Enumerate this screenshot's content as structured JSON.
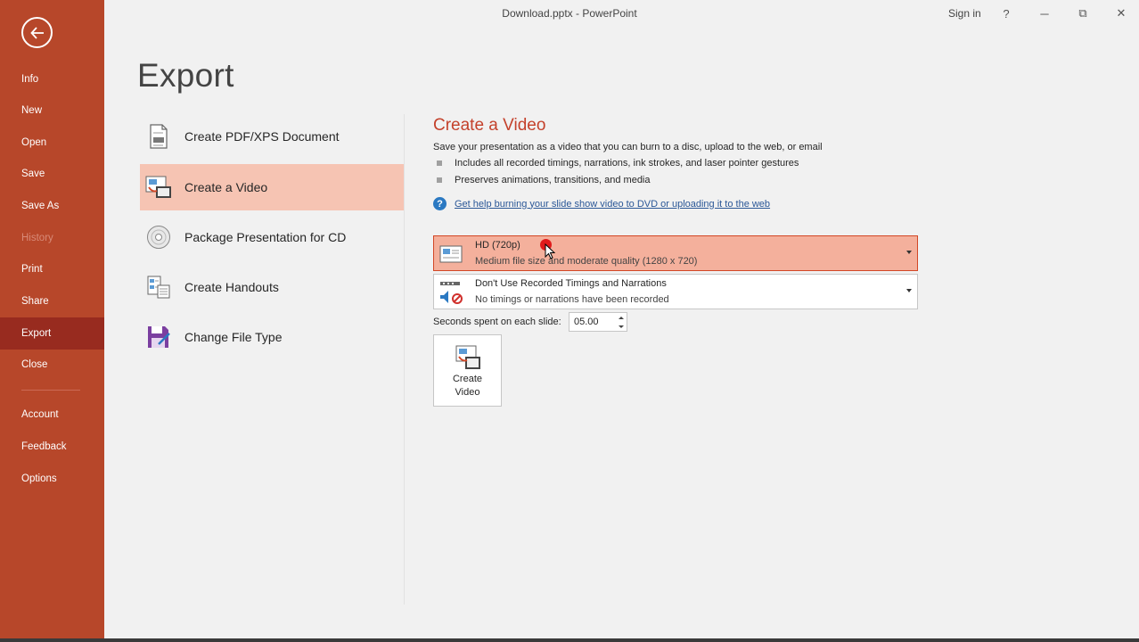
{
  "window": {
    "title": "Download.pptx  -  PowerPoint",
    "sign_in": "Sign in",
    "help": "?",
    "minimize": "─",
    "restore": "⧉",
    "close": "✕"
  },
  "sidebar": {
    "items": [
      {
        "label": "Info"
      },
      {
        "label": "New"
      },
      {
        "label": "Open"
      },
      {
        "label": "Save"
      },
      {
        "label": "Save As"
      },
      {
        "label": "History"
      },
      {
        "label": "Print"
      },
      {
        "label": "Share"
      },
      {
        "label": "Export"
      },
      {
        "label": "Close"
      },
      {
        "label": "Account"
      },
      {
        "label": "Feedback"
      },
      {
        "label": "Options"
      }
    ],
    "active": "Export",
    "disabled": "History"
  },
  "page": {
    "title": "Export"
  },
  "export_options": [
    {
      "label": "Create PDF/XPS Document",
      "icon": "pdf-document-icon"
    },
    {
      "label": "Create a Video",
      "icon": "video-icon"
    },
    {
      "label": "Package Presentation for CD",
      "icon": "cd-icon"
    },
    {
      "label": "Create Handouts",
      "icon": "handouts-icon"
    },
    {
      "label": "Change File Type",
      "icon": "save-file-type-icon"
    }
  ],
  "video_pane": {
    "title": "Create a Video",
    "description": "Save your presentation as a video that you can burn to a disc, upload to the web, or email",
    "bullets": [
      "Includes all recorded timings, narrations, ink strokes, and laser pointer gestures",
      "Preserves animations, transitions, and media"
    ],
    "help_link": "Get help burning your slide show video to DVD or uploading it to the web",
    "quality": {
      "title": "HD (720p)",
      "subtitle": "Medium file size and moderate quality (1280 x 720)"
    },
    "timings": {
      "title": "Don't Use Recorded Timings and Narrations",
      "subtitle": "No timings or narrations have been recorded"
    },
    "seconds_label": "Seconds spent on each slide:",
    "seconds_value": "05.00",
    "create_button": {
      "line1": "Create",
      "line2": "Video"
    }
  },
  "colors": {
    "sidebar": "#b7472a",
    "sidebar_active": "#982b1f",
    "accent": "#c4412b",
    "selected_option": "#f6c4b3",
    "highlighted_dropdown": "#f4b09c"
  }
}
